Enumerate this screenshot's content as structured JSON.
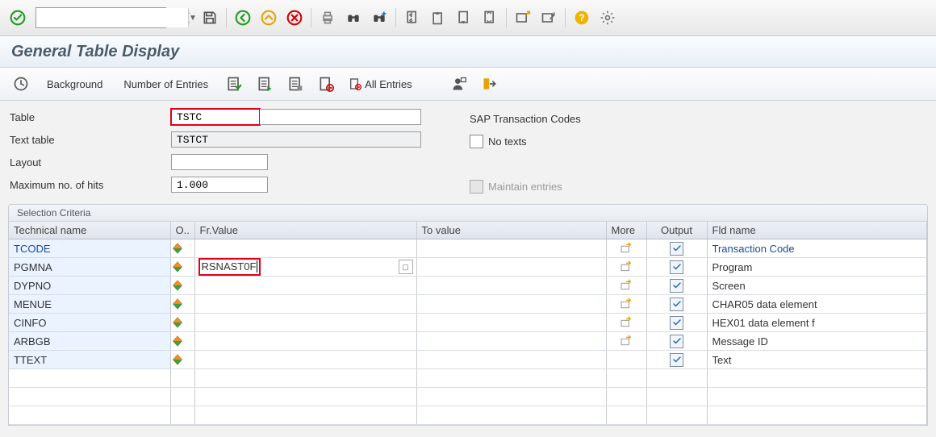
{
  "title": "General Table Display",
  "main_toolbar": {
    "tcode_value": ""
  },
  "app_toolbar": {
    "background_label": "Background",
    "num_entries_label": "Number of Entries",
    "all_entries_label": "All Entries"
  },
  "form": {
    "table_label": "Table",
    "table_value": "TSTC",
    "text_table_label": "Text table",
    "text_table_value": "TSTCT",
    "layout_label": "Layout",
    "layout_value": "",
    "max_hits_label": "Maximum no. of hits",
    "max_hits_value": "1.000",
    "table_desc": "SAP Transaction Codes",
    "no_texts_label": "No texts",
    "maintain_label": "Maintain entries"
  },
  "selection": {
    "group_title": "Selection Criteria",
    "headers": {
      "tech": "Technical name",
      "op": "O..",
      "frv": "Fr.Value",
      "tov": "To value",
      "more": "More",
      "outp": "Output",
      "fld": "Fld name"
    },
    "rows": [
      {
        "tech": "TCODE",
        "tech_link": true,
        "frv": "",
        "fld": "Transaction Code",
        "fld_link": true,
        "has_more": true,
        "output": true,
        "f4": false,
        "frv_hl": false
      },
      {
        "tech": "PGMNA",
        "tech_link": false,
        "frv": "RSNAST0F",
        "fld": "Program",
        "fld_link": false,
        "has_more": true,
        "output": true,
        "f4": true,
        "frv_hl": true
      },
      {
        "tech": "DYPNO",
        "tech_link": false,
        "frv": "",
        "fld": "Screen",
        "fld_link": false,
        "has_more": true,
        "output": true,
        "f4": false,
        "frv_hl": false
      },
      {
        "tech": "MENUE",
        "tech_link": false,
        "frv": "",
        "fld": "CHAR05 data element",
        "fld_link": false,
        "has_more": true,
        "output": true,
        "f4": false,
        "frv_hl": false
      },
      {
        "tech": "CINFO",
        "tech_link": false,
        "frv": "",
        "fld": "HEX01 data element f",
        "fld_link": false,
        "has_more": true,
        "output": true,
        "f4": false,
        "frv_hl": false
      },
      {
        "tech": "ARBGB",
        "tech_link": false,
        "frv": "",
        "fld": "Message ID",
        "fld_link": false,
        "has_more": true,
        "output": true,
        "f4": false,
        "frv_hl": false
      },
      {
        "tech": "TTEXT",
        "tech_link": false,
        "frv": "",
        "fld": "Text",
        "fld_link": false,
        "has_more": false,
        "output": true,
        "f4": false,
        "frv_hl": false
      }
    ],
    "empty_rows": 3
  }
}
